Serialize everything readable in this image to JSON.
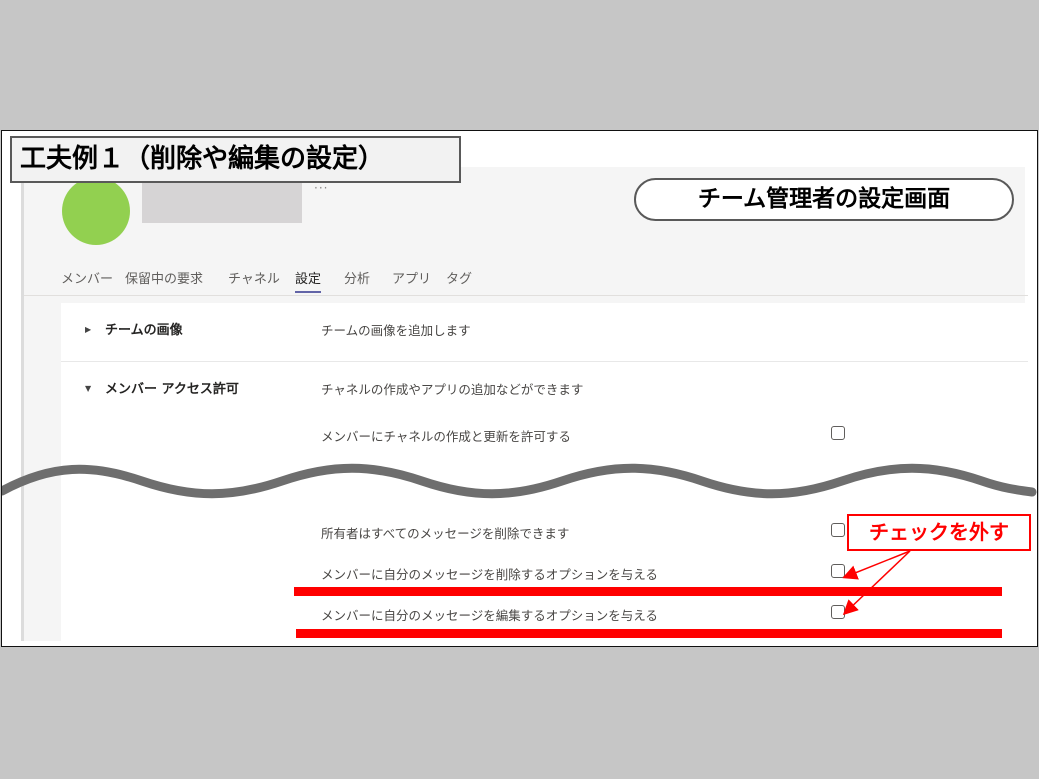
{
  "slide": {
    "title": "工夫例１（削除や編集の設定）",
    "screen_label": "チーム管理者の設定画面",
    "callout": "チェックを外す"
  },
  "team": {
    "more": "···",
    "avatar_color": "#92d050"
  },
  "tabs": [
    {
      "label": "メンバー",
      "active": false
    },
    {
      "label": "保留中の要求",
      "active": false
    },
    {
      "label": "チャネル",
      "active": false
    },
    {
      "label": "設定",
      "active": true
    },
    {
      "label": "分析",
      "active": false
    },
    {
      "label": "アプリ",
      "active": false
    },
    {
      "label": "タグ",
      "active": false
    }
  ],
  "settings": {
    "team_image": {
      "title": "チームの画像",
      "desc": "チームの画像を追加します"
    },
    "member_access": {
      "title": "メンバー アクセス許可",
      "desc": "チャネルの作成やアプリの追加などができます",
      "options": [
        {
          "label": "メンバーにチャネルの作成と更新を許可する",
          "checked": false
        },
        {
          "label": "所有者はすべてのメッセージを削除できます",
          "checked": false
        },
        {
          "label": "メンバーに自分のメッセージを削除するオプションを与える",
          "checked": false
        },
        {
          "label": "メンバーに自分のメッセージを編集するオプションを与える",
          "checked": false
        }
      ]
    }
  },
  "colors": {
    "highlight": "#ff0000",
    "tab_underline": "#6264a7"
  }
}
